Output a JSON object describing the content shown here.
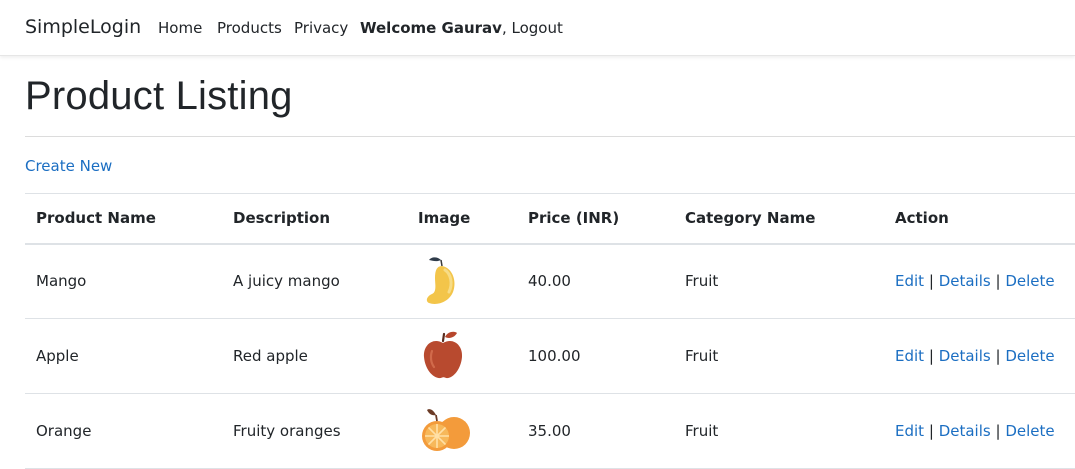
{
  "nav": {
    "brand": "SimpleLogin",
    "links": [
      "Home",
      "Products",
      "Privacy"
    ],
    "welcome_name": "Welcome Gaurav",
    "welcome_sep": ", ",
    "logout": "Logout"
  },
  "page": {
    "title": "Product Listing",
    "create_new": "Create New"
  },
  "table": {
    "headers": [
      "Product Name",
      "Description",
      "Image",
      "Price (INR)",
      "Category Name",
      "Action"
    ],
    "rows": [
      {
        "name": "Mango",
        "description": "A juicy mango",
        "image_icon": "mango-icon",
        "price": "40.00",
        "category": "Fruit"
      },
      {
        "name": "Apple",
        "description": "Red apple",
        "image_icon": "apple-icon",
        "price": "100.00",
        "category": "Fruit"
      },
      {
        "name": "Orange",
        "description": "Fruity oranges",
        "image_icon": "orange-icon",
        "price": "35.00",
        "category": "Fruit"
      }
    ],
    "actions": {
      "edit": "Edit",
      "details": "Details",
      "delete": "Delete",
      "separator": "|"
    }
  },
  "colors": {
    "link": "#1b6ec2",
    "text": "#212529",
    "border": "#dee2e6"
  }
}
